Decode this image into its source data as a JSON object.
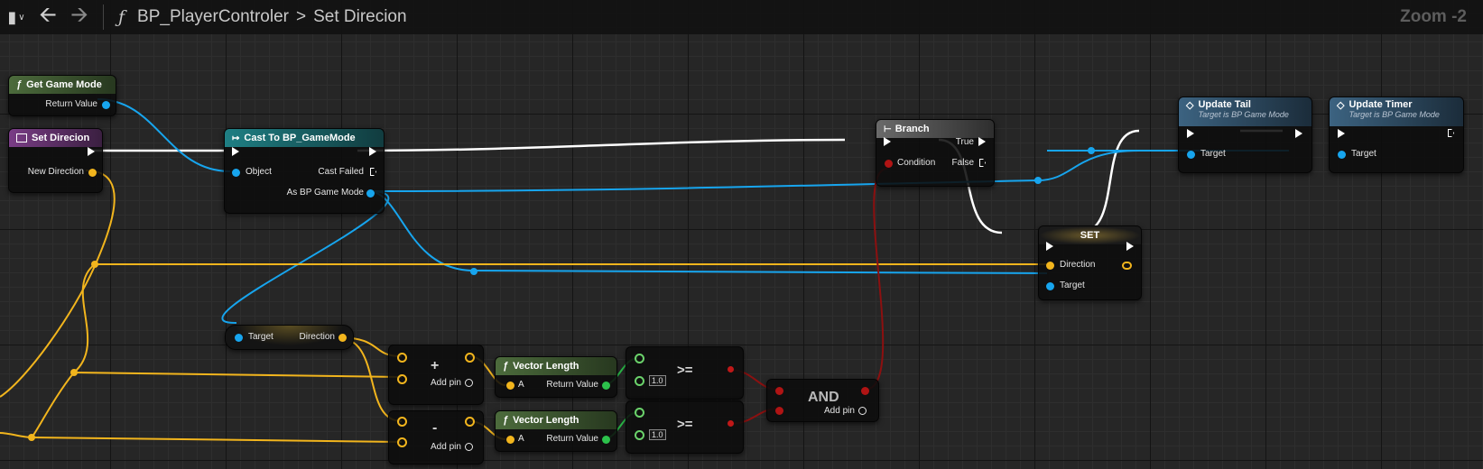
{
  "toolbar": {
    "bookmark_icon": "bookmark-icon",
    "function_symbol": "ƒ",
    "graph_name": "BP_PlayerControler",
    "separator": ">",
    "function_name": "Set Direcion",
    "zoom": "Zoom -2"
  },
  "nodes": {
    "get_game_mode": {
      "title": "Get Game Mode",
      "return": "Return Value"
    },
    "set_direcion": {
      "title": "Set Direcion",
      "new_direction": "New Direction"
    },
    "cast": {
      "title": "Cast To BP_GameMode",
      "object": "Object",
      "cast_failed": "Cast Failed",
      "as": "As BP Game Mode"
    },
    "branch": {
      "title": "Branch",
      "condition": "Condition",
      "true": "True",
      "false": "False"
    },
    "set": {
      "title": "SET",
      "direction": "Direction",
      "target": "Target"
    },
    "update_tail": {
      "title": "Update Tail",
      "subtitle": "Target is BP Game Mode",
      "target": "Target"
    },
    "update_timer": {
      "title": "Update Timer",
      "subtitle": "Target is BP Game Mode",
      "target": "Target"
    },
    "get_direction": {
      "target": "Target",
      "direction": "Direction"
    },
    "add": {
      "symbol": "+",
      "add_pin": "Add pin"
    },
    "sub": {
      "symbol": "-",
      "add_pin": "Add pin"
    },
    "vlen1": {
      "title": "Vector Length",
      "a": "A",
      "return": "Return Value"
    },
    "vlen2": {
      "title": "Vector Length",
      "a": "A",
      "return": "Return Value"
    },
    "gte1": {
      "symbol": ">=",
      "value": "1.0"
    },
    "gte2": {
      "symbol": ">=",
      "value": "1.0"
    },
    "and": {
      "symbol": "AND",
      "add_pin": "Add pin"
    }
  },
  "colors": {
    "exec": "#ffffff",
    "object": "#17a5ee",
    "vector": "#f2b51d",
    "float": "#2cc14b",
    "bool": "#b01414"
  }
}
